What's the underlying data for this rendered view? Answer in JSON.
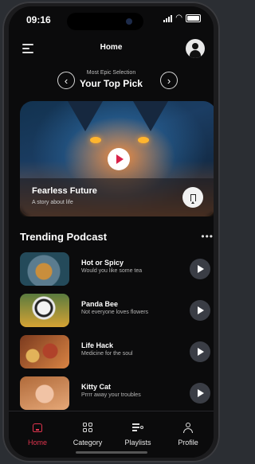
{
  "status": {
    "time": "09:16"
  },
  "header": {
    "title": "Home"
  },
  "selection": {
    "subtitle": "Most Epic Selection",
    "title": "Your Top Pick"
  },
  "hero": {
    "title": "Fearless Future",
    "subtitle": "A story about life"
  },
  "trending": {
    "title": "Trending Podcast",
    "items": [
      {
        "title": "Hot or Spicy",
        "subtitle": "Would you like some tea"
      },
      {
        "title": "Panda Bee",
        "subtitle": "Not everyone loves flowers"
      },
      {
        "title": "Life Hack",
        "subtitle": "Medicine for the soul"
      },
      {
        "title": "Kitty Cat",
        "subtitle": "Prrrr away your troubles"
      }
    ]
  },
  "tabs": [
    {
      "label": "Home",
      "active": true
    },
    {
      "label": "Category",
      "active": false
    },
    {
      "label": "Playlists",
      "active": false
    },
    {
      "label": "Profile",
      "active": false
    }
  ],
  "colors": {
    "accent": "#e0344e",
    "background": "#0b0b0c"
  },
  "icons": [
    "menu-icon",
    "avatar-icon",
    "chevron-left-icon",
    "chevron-right-icon",
    "play-icon",
    "bookmark-icon",
    "more-icon",
    "home-icon",
    "category-icon",
    "playlists-icon",
    "profile-icon"
  ]
}
